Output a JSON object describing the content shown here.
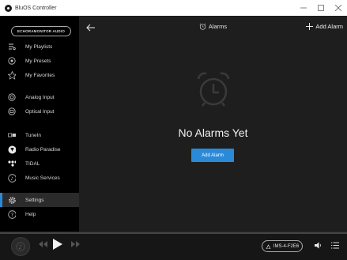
{
  "window": {
    "title": "BluOS Controller",
    "controls": [
      "minimize-icon",
      "maximize-icon",
      "close-icon"
    ]
  },
  "sidebar": {
    "brand": "ECHORAMONITOR AUDIO",
    "items": [
      {
        "label": "My Playlists",
        "icon": "playlist-icon"
      },
      {
        "label": "My Presets",
        "icon": "preset-icon"
      },
      {
        "label": "My Favorites",
        "icon": "star-icon"
      },
      {
        "label": "Analog Input",
        "icon": "analog-input-icon"
      },
      {
        "label": "Optical Input",
        "icon": "optical-input-icon"
      },
      {
        "label": "TuneIn",
        "icon": "tunein-icon"
      },
      {
        "label": "Radio Paradise",
        "icon": "radio-paradise-icon"
      },
      {
        "label": "TIDAL",
        "icon": "tidal-icon"
      },
      {
        "label": "Music Services",
        "icon": "music-services-icon"
      },
      {
        "label": "Settings",
        "icon": "gear-icon",
        "selected": true
      },
      {
        "label": "Help",
        "icon": "help-icon"
      }
    ]
  },
  "header": {
    "title": "Alarms",
    "add_label": "Add Alarm"
  },
  "main": {
    "empty_text": "No Alarms Yet",
    "add_button": "Add Alarm"
  },
  "player": {
    "device": "IMS-4-F2E6"
  },
  "colors": {
    "accent": "#2a8ad8",
    "background": "#1e1e1e",
    "sidebar": "#000000"
  }
}
